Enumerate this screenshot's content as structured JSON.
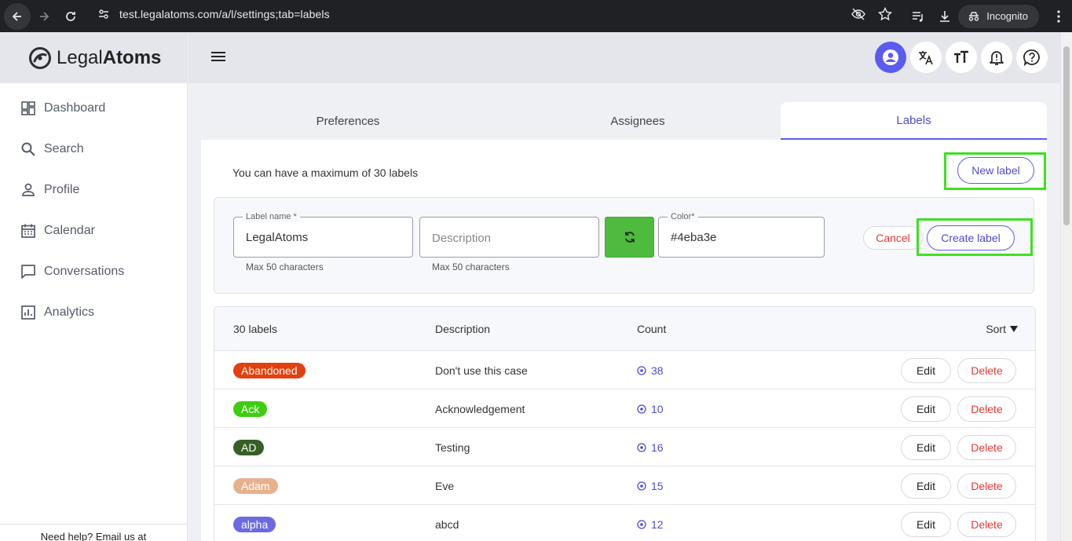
{
  "browser": {
    "url": "test.legalatoms.com/a/l/settings;tab=labels",
    "incognito_label": "Incognito"
  },
  "brand": {
    "name_light": "Legal",
    "name_bold": "Atoms"
  },
  "sidebar": {
    "items": [
      {
        "label": "Dashboard",
        "icon": "dashboard-icon"
      },
      {
        "label": "Search",
        "icon": "search-icon"
      },
      {
        "label": "Profile",
        "icon": "person-icon"
      },
      {
        "label": "Calendar",
        "icon": "calendar-icon"
      },
      {
        "label": "Conversations",
        "icon": "chat-icon"
      },
      {
        "label": "Analytics",
        "icon": "analytics-icon"
      }
    ],
    "footer": "Need help? Email us at"
  },
  "tabs": [
    {
      "label": "Preferences"
    },
    {
      "label": "Assignees"
    },
    {
      "label": "Labels"
    }
  ],
  "labels_page": {
    "max_text": "You can have a maximum of 30 labels",
    "new_label_button": "New label",
    "form": {
      "name_legend": "Label name *",
      "name_value": "LegalAtoms",
      "name_helper": "Max 50 characters",
      "description_placeholder": "Description",
      "description_helper": "Max 50 characters",
      "color_legend": "Color*",
      "color_value": "#4eba3e",
      "cancel_button": "Cancel",
      "create_button": "Create label"
    },
    "table": {
      "headers": {
        "labels": "30 labels",
        "description": "Description",
        "count": "Count",
        "sort": "Sort"
      },
      "edit_label": "Edit",
      "delete_label": "Delete",
      "rows": [
        {
          "name": "Abandoned",
          "color": "#e2410f",
          "description": "Don't use this case",
          "count": "38"
        },
        {
          "name": "Ack",
          "color": "#3fcd12",
          "description": "Acknowledgement",
          "count": "10"
        },
        {
          "name": "AD",
          "color": "#385f25",
          "description": "Testing",
          "count": "16"
        },
        {
          "name": "Adam",
          "color": "#e8b18e",
          "description": "Eve",
          "count": "15"
        },
        {
          "name": "alpha",
          "color": "#6c6ae0",
          "description": "abcd",
          "count": "12"
        }
      ]
    }
  },
  "colors": {
    "accent": "#5b5bf0",
    "refresh_green": "#4eba3e",
    "danger": "#e53935",
    "highlight": "#3fe021"
  }
}
